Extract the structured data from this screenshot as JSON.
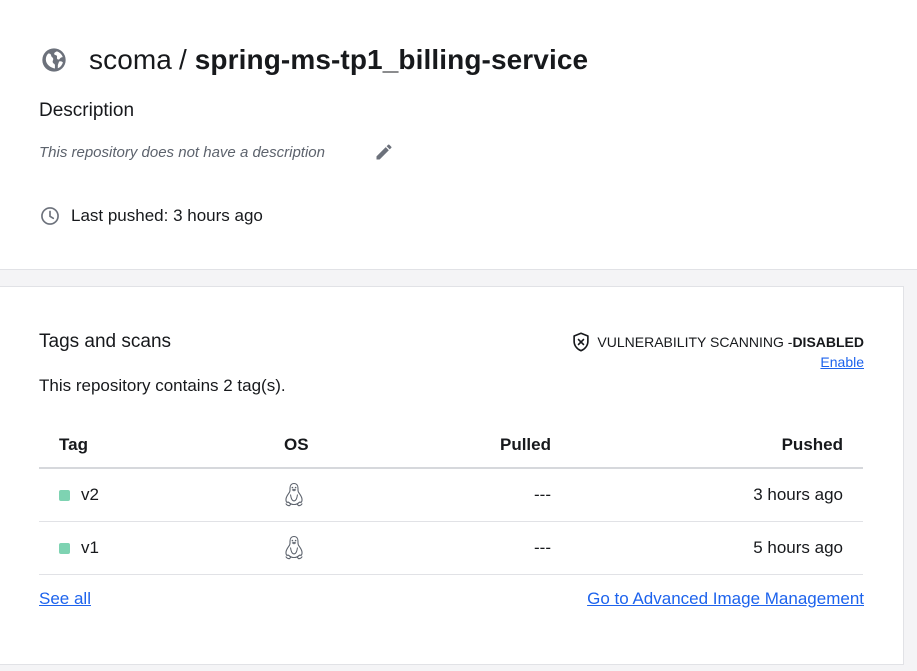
{
  "repo": {
    "namespace": "scoma",
    "separator": "/",
    "name": "spring-ms-tp1_billing-service",
    "icon": "globe-icon"
  },
  "description": {
    "heading": "Description",
    "text": "This repository does not have a description",
    "edit_icon": "pencil-icon"
  },
  "last_pushed": {
    "icon": "clock-icon",
    "text": "Last pushed: 3 hours ago"
  },
  "tags_section": {
    "heading": "Tags and scans",
    "vuln_label": "VULNERABILITY SCANNING - ",
    "vuln_status": "DISABLED",
    "vuln_icon": "shield-x-icon",
    "enable_link": "Enable",
    "count_text": "This repository contains 2 tag(s).",
    "columns": {
      "tag": "Tag",
      "os": "OS",
      "pulled": "Pulled",
      "pushed": "Pushed"
    },
    "rows": [
      {
        "tag": "v2",
        "os_icon": "linux-icon",
        "pulled": "---",
        "pushed": "3 hours ago",
        "status_color": "#7ed3b2"
      },
      {
        "tag": "v1",
        "os_icon": "linux-icon",
        "pulled": "---",
        "pushed": "5 hours ago",
        "status_color": "#7ed3b2"
      }
    ],
    "see_all": "See all",
    "advanced_link": "Go to Advanced Image Management"
  },
  "colors": {
    "link": "#1d63ed",
    "text": "#17191c",
    "muted": "#5d636d",
    "background": "#f4f4f6"
  }
}
